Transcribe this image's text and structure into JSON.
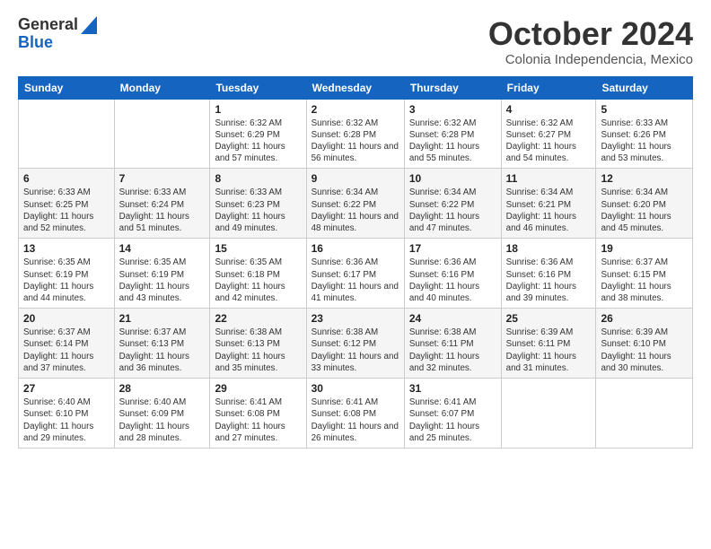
{
  "logo": {
    "general": "General",
    "blue": "Blue"
  },
  "header": {
    "month": "October 2024",
    "location": "Colonia Independencia, Mexico"
  },
  "weekdays": [
    "Sunday",
    "Monday",
    "Tuesday",
    "Wednesday",
    "Thursday",
    "Friday",
    "Saturday"
  ],
  "weeks": [
    [
      {
        "day": "",
        "info": ""
      },
      {
        "day": "",
        "info": ""
      },
      {
        "day": "1",
        "info": "Sunrise: 6:32 AM\nSunset: 6:29 PM\nDaylight: 11 hours and 57 minutes."
      },
      {
        "day": "2",
        "info": "Sunrise: 6:32 AM\nSunset: 6:28 PM\nDaylight: 11 hours and 56 minutes."
      },
      {
        "day": "3",
        "info": "Sunrise: 6:32 AM\nSunset: 6:28 PM\nDaylight: 11 hours and 55 minutes."
      },
      {
        "day": "4",
        "info": "Sunrise: 6:32 AM\nSunset: 6:27 PM\nDaylight: 11 hours and 54 minutes."
      },
      {
        "day": "5",
        "info": "Sunrise: 6:33 AM\nSunset: 6:26 PM\nDaylight: 11 hours and 53 minutes."
      }
    ],
    [
      {
        "day": "6",
        "info": "Sunrise: 6:33 AM\nSunset: 6:25 PM\nDaylight: 11 hours and 52 minutes."
      },
      {
        "day": "7",
        "info": "Sunrise: 6:33 AM\nSunset: 6:24 PM\nDaylight: 11 hours and 51 minutes."
      },
      {
        "day": "8",
        "info": "Sunrise: 6:33 AM\nSunset: 6:23 PM\nDaylight: 11 hours and 49 minutes."
      },
      {
        "day": "9",
        "info": "Sunrise: 6:34 AM\nSunset: 6:22 PM\nDaylight: 11 hours and 48 minutes."
      },
      {
        "day": "10",
        "info": "Sunrise: 6:34 AM\nSunset: 6:22 PM\nDaylight: 11 hours and 47 minutes."
      },
      {
        "day": "11",
        "info": "Sunrise: 6:34 AM\nSunset: 6:21 PM\nDaylight: 11 hours and 46 minutes."
      },
      {
        "day": "12",
        "info": "Sunrise: 6:34 AM\nSunset: 6:20 PM\nDaylight: 11 hours and 45 minutes."
      }
    ],
    [
      {
        "day": "13",
        "info": "Sunrise: 6:35 AM\nSunset: 6:19 PM\nDaylight: 11 hours and 44 minutes."
      },
      {
        "day": "14",
        "info": "Sunrise: 6:35 AM\nSunset: 6:19 PM\nDaylight: 11 hours and 43 minutes."
      },
      {
        "day": "15",
        "info": "Sunrise: 6:35 AM\nSunset: 6:18 PM\nDaylight: 11 hours and 42 minutes."
      },
      {
        "day": "16",
        "info": "Sunrise: 6:36 AM\nSunset: 6:17 PM\nDaylight: 11 hours and 41 minutes."
      },
      {
        "day": "17",
        "info": "Sunrise: 6:36 AM\nSunset: 6:16 PM\nDaylight: 11 hours and 40 minutes."
      },
      {
        "day": "18",
        "info": "Sunrise: 6:36 AM\nSunset: 6:16 PM\nDaylight: 11 hours and 39 minutes."
      },
      {
        "day": "19",
        "info": "Sunrise: 6:37 AM\nSunset: 6:15 PM\nDaylight: 11 hours and 38 minutes."
      }
    ],
    [
      {
        "day": "20",
        "info": "Sunrise: 6:37 AM\nSunset: 6:14 PM\nDaylight: 11 hours and 37 minutes."
      },
      {
        "day": "21",
        "info": "Sunrise: 6:37 AM\nSunset: 6:13 PM\nDaylight: 11 hours and 36 minutes."
      },
      {
        "day": "22",
        "info": "Sunrise: 6:38 AM\nSunset: 6:13 PM\nDaylight: 11 hours and 35 minutes."
      },
      {
        "day": "23",
        "info": "Sunrise: 6:38 AM\nSunset: 6:12 PM\nDaylight: 11 hours and 33 minutes."
      },
      {
        "day": "24",
        "info": "Sunrise: 6:38 AM\nSunset: 6:11 PM\nDaylight: 11 hours and 32 minutes."
      },
      {
        "day": "25",
        "info": "Sunrise: 6:39 AM\nSunset: 6:11 PM\nDaylight: 11 hours and 31 minutes."
      },
      {
        "day": "26",
        "info": "Sunrise: 6:39 AM\nSunset: 6:10 PM\nDaylight: 11 hours and 30 minutes."
      }
    ],
    [
      {
        "day": "27",
        "info": "Sunrise: 6:40 AM\nSunset: 6:10 PM\nDaylight: 11 hours and 29 minutes."
      },
      {
        "day": "28",
        "info": "Sunrise: 6:40 AM\nSunset: 6:09 PM\nDaylight: 11 hours and 28 minutes."
      },
      {
        "day": "29",
        "info": "Sunrise: 6:41 AM\nSunset: 6:08 PM\nDaylight: 11 hours and 27 minutes."
      },
      {
        "day": "30",
        "info": "Sunrise: 6:41 AM\nSunset: 6:08 PM\nDaylight: 11 hours and 26 minutes."
      },
      {
        "day": "31",
        "info": "Sunrise: 6:41 AM\nSunset: 6:07 PM\nDaylight: 11 hours and 25 minutes."
      },
      {
        "day": "",
        "info": ""
      },
      {
        "day": "",
        "info": ""
      }
    ]
  ]
}
